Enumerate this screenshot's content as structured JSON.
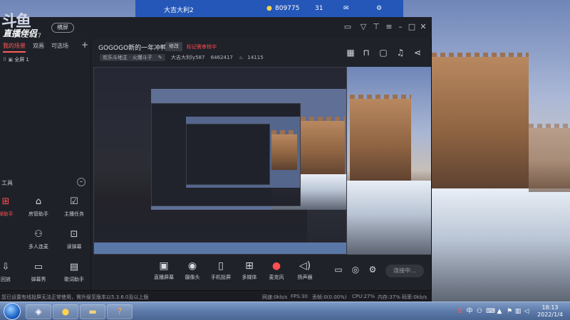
{
  "app": {
    "logo_text": "直播伴侣",
    "logo_glyph": "斗鱼",
    "room_id": "6462417",
    "mode_pill": "横屏"
  },
  "background_topbar": {
    "nickname": "大吉大利2",
    "coins": "809775",
    "level": "31"
  },
  "left_panel": {
    "tabs": [
      "我的场景",
      "双画",
      "可选场"
    ],
    "scene_label": "全屏 1",
    "tools_title": "工具",
    "tools": [
      {
        "label": "房管助手",
        "icon": "house-icon"
      },
      {
        "label": "主播任务",
        "icon": "task-icon"
      },
      {
        "label": "多人连麦",
        "icon": "multi-user-icon"
      },
      {
        "label": "读弹幕",
        "icon": "danmaku-read-icon"
      },
      {
        "label": "弹幕秀",
        "icon": "danmaku-show-icon"
      },
      {
        "label": "歌词助手",
        "icon": "lyrics-icon"
      }
    ],
    "partial_tools": [
      "弹助手",
      "回放"
    ]
  },
  "stream": {
    "title": "GOGOGO新的一年冲鸭",
    "edit_label": "修改",
    "review_status": "标记需审核中",
    "category": "欢乐斗地主 · 火爆斗子",
    "level_text": "大吉大利ly587",
    "room_id": "6462417",
    "heat": "14115"
  },
  "bottom_toolbar": [
    {
      "label": "直播屏幕",
      "icon": "screen-icon"
    },
    {
      "label": "摄像头",
      "icon": "camera-icon"
    },
    {
      "label": "手机投屏",
      "icon": "phone-cast-icon"
    },
    {
      "label": "多媒体",
      "icon": "media-icon"
    },
    {
      "label": "麦克风",
      "icon": "mic-icon"
    },
    {
      "label": "扬声器",
      "icon": "speaker-icon"
    }
  ],
  "live_button": "连接中...",
  "status_bar": {
    "notice": "您已设置有线投屏无法正常使用，需升级至版本以5.3.6.0及以上版",
    "speed": "网速:0kb/s",
    "fps": "FPS:30",
    "drop": "丢帧:0(0.00%)",
    "cpu": "CPU:27%",
    "mem": "内存:37%",
    "bitrate": "码率:0kb/s"
  },
  "taskbar": {
    "time": "18:13",
    "date": "2022/1/4"
  },
  "colors": {
    "accent_red": "#ff4f4f",
    "window_bg": "#20222a",
    "taskbar_blue": "#5a78a7"
  }
}
